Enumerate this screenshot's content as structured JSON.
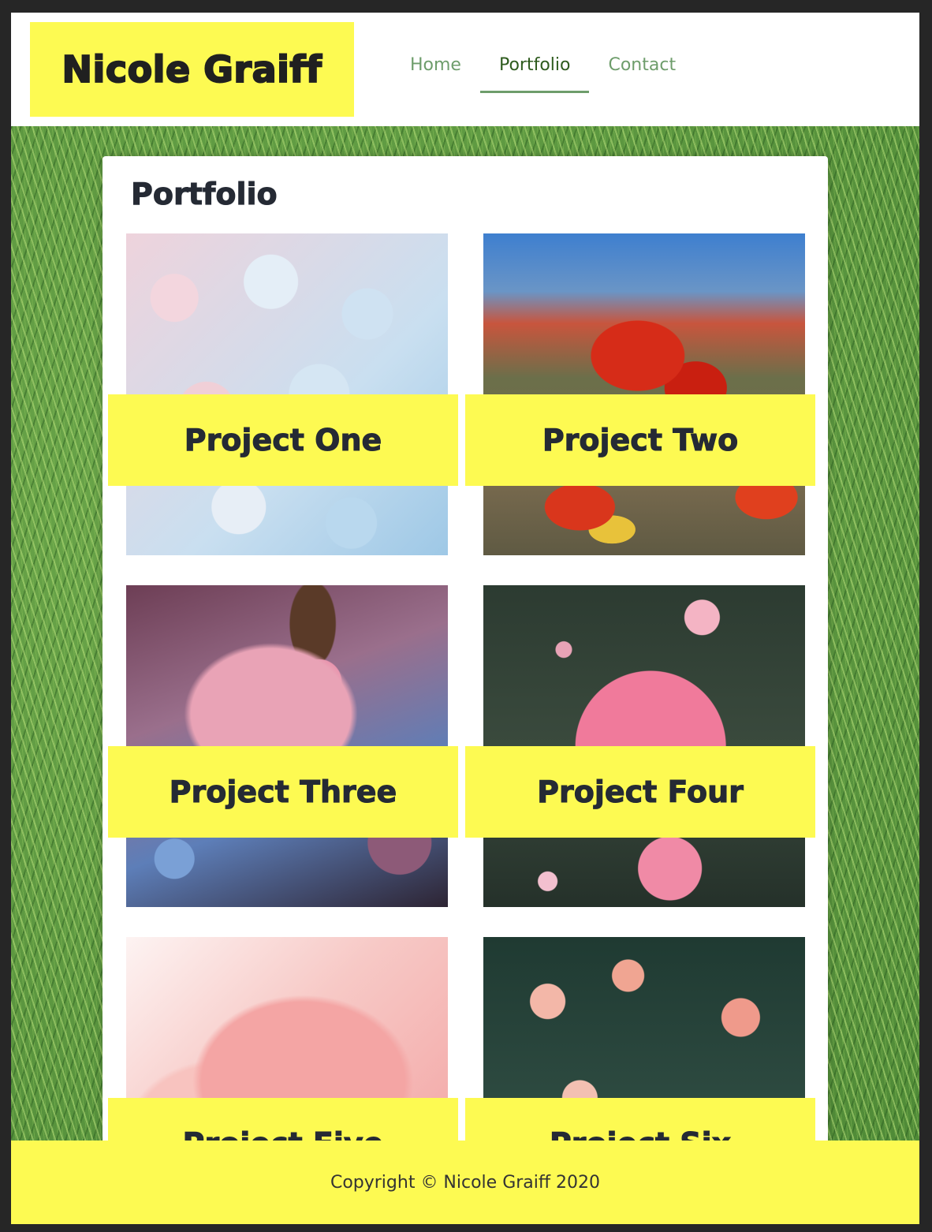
{
  "header": {
    "logo": "Nicole Graiff",
    "nav": [
      {
        "label": "Home",
        "active": false
      },
      {
        "label": "Portfolio",
        "active": true
      },
      {
        "label": "Contact",
        "active": false
      }
    ]
  },
  "main": {
    "title": "Portfolio",
    "projects": [
      {
        "label": "Project One",
        "image": "hydrangea-photo"
      },
      {
        "label": "Project Two",
        "image": "poppy-photo"
      },
      {
        "label": "Project Three",
        "image": "cherry-blossom-photo"
      },
      {
        "label": "Project Four",
        "image": "pink-rose-photo"
      },
      {
        "label": "Project Five",
        "image": "peony-photo"
      },
      {
        "label": "Project Six",
        "image": "chrysanthemum-photo"
      }
    ]
  },
  "footer": {
    "copyright": "Copyright © Nicole Graiff 2020"
  },
  "colors": {
    "accent_yellow": "#fdfa52",
    "nav_green": "#6e9d6b",
    "nav_active": "#2e5b1e",
    "heading_text": "#252a34"
  }
}
